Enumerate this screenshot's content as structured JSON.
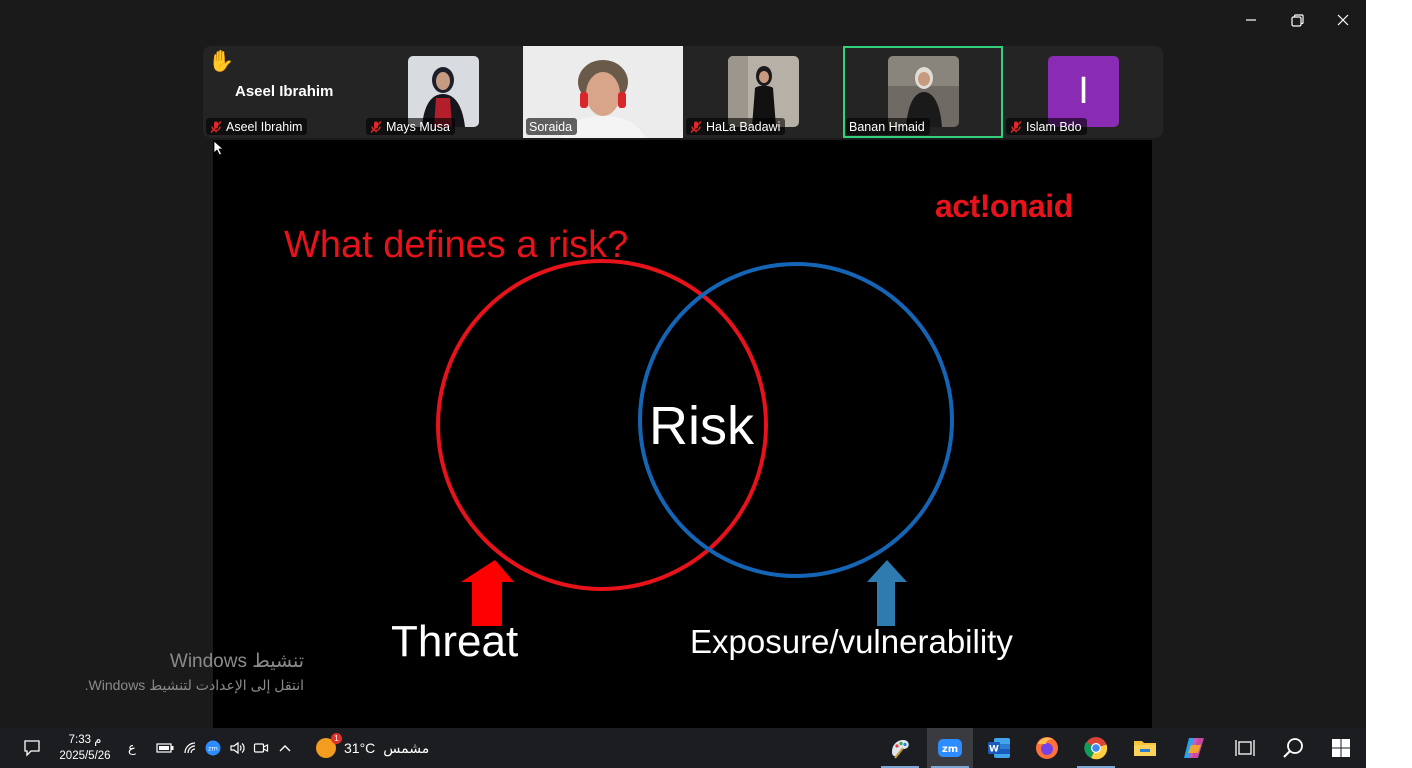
{
  "participants": [
    {
      "display_name": "Aseel Ibrahim",
      "label": "Aseel Ibrahim",
      "muted": true,
      "hand_raised": true
    },
    {
      "label": "Mays Musa",
      "muted": true
    },
    {
      "label": "Soraida",
      "muted": false
    },
    {
      "label": "HaLa Badawi",
      "muted": true
    },
    {
      "label": "Banan Hmaid",
      "muted": false,
      "active_speaker": true
    },
    {
      "label": "Islam Bdo",
      "muted": true,
      "initial": "I"
    }
  ],
  "slide": {
    "title": "What defines a risk?",
    "logo": "act!onaid",
    "center_label": "Risk",
    "left_label": "Threat",
    "right_label": "Exposure/vulnerability"
  },
  "activation": {
    "title": "تنشيط Windows",
    "subtitle": "انتقل إلى الإعدادت لتنشيط Windows."
  },
  "taskbar": {
    "time": "7:33 م",
    "date": "2025/5/26",
    "language": "ع",
    "temperature": "31°C",
    "weather": "مشمس",
    "weather_badge": "1"
  },
  "colors": {
    "accent_red": "#e8131a",
    "circle_blue": "#1565b6",
    "active_border": "#34d17c",
    "avatar_purple": "#8a2bb3"
  }
}
